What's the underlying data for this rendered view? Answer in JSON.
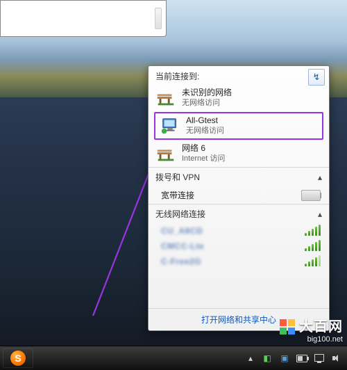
{
  "flyout": {
    "header": "当前连接到:",
    "diag_icon": "diagnose-icon",
    "networks": [
      {
        "icon": "bench",
        "name": "未识别的网络",
        "sub": "无网络访问"
      },
      {
        "icon": "monitor",
        "name": "All-Gtest",
        "sub": "无网络访问",
        "highlighted": true
      },
      {
        "icon": "bench",
        "name": "网络  6",
        "sub": "Internet 访问"
      }
    ],
    "dial_section": "拨号和 VPN",
    "broadband_label": "宽带连接",
    "wifi_section": "无线网络连接",
    "wifi_items": [
      {
        "label": "CU_A8CD",
        "strength": 5
      },
      {
        "label": "CMCC-Lte",
        "strength": 5
      },
      {
        "label": "C-Free2G",
        "strength": 4
      }
    ],
    "footer_link": "打开网络和共享中心"
  },
  "taskbar": {
    "sogou": "S"
  },
  "watermark": {
    "cn": "大百网",
    "url": "big100.net"
  }
}
